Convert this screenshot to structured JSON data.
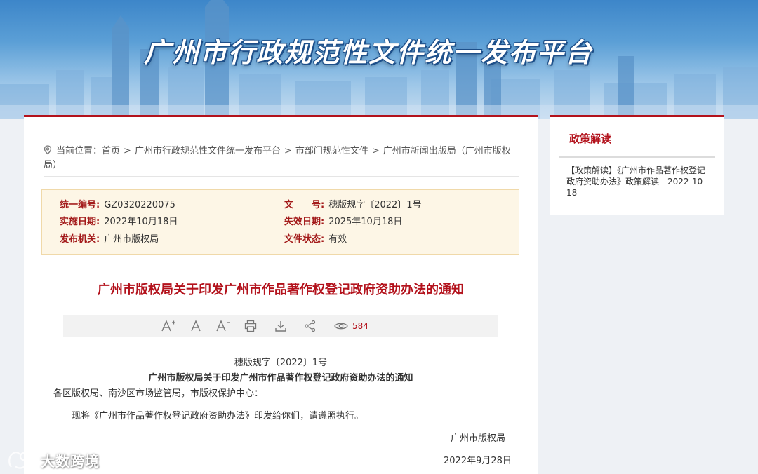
{
  "banner": {
    "title": "广州市行政规范性文件统一发布平台"
  },
  "breadcrumb": {
    "prefix": "当前位置：",
    "items": [
      "首页",
      "广州市行政规范性文件统一发布平台",
      "市部门规范性文件",
      "广州市新闻出版局（广州市版权局）"
    ],
    "separator": ">"
  },
  "meta": {
    "serial_label": "统一编号:",
    "serial_value": "GZ0320220075",
    "docno_label": "文　　号:",
    "docno_value": "穗版规字〔2022〕1号",
    "effective_label": "实施日期:",
    "effective_value": "2022年10月18日",
    "expiry_label": "失效日期:",
    "expiry_value": "2025年10月18日",
    "issuer_label": "发布机关:",
    "issuer_value": "广州市版权局",
    "status_label": "文件状态:",
    "status_value": "有效"
  },
  "document": {
    "title": "广州市版权局关于印发广州市作品著作权登记政府资助办法的通知",
    "docno": "穗版规字〔2022〕1号",
    "subtitle": "广州市版权局关于印发广州市作品著作权登记政府资助办法的通知",
    "recipients": "各区版权局、南沙区市场监管局，市版权保护中心：",
    "body": "现将《广州市作品著作权登记政府资助办法》印发给你们，请遵照执行。",
    "signer": "广州市版权局",
    "date": "2022年9月28日"
  },
  "toolbar": {
    "icons": [
      "font-increase-icon",
      "font-normal-icon",
      "font-decrease-icon",
      "print-icon",
      "download-icon",
      "share-icon",
      "eye-icon"
    ],
    "view_count": "584"
  },
  "side": {
    "title": "政策解读",
    "item": "【政策解读】《广州市作品著作权登记政府资助办法》政策解读　2022-10-18"
  },
  "watermark": {
    "text": "大数跨境"
  },
  "colors": {
    "accent": "#b3121c",
    "meta_bg": "#fdf6e6",
    "meta_border": "#f0d9a9"
  }
}
